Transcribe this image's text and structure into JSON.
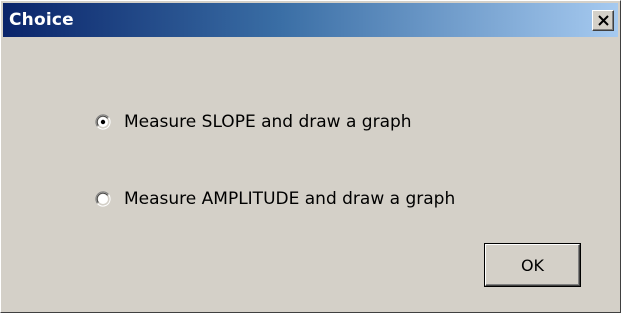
{
  "window": {
    "title": "Choice",
    "close_icon": "close-x-icon"
  },
  "options": [
    {
      "label": "Measure SLOPE and draw a graph",
      "selected": true
    },
    {
      "label": "Measure AMPLITUDE and draw a graph",
      "selected": false
    }
  ],
  "buttons": {
    "ok_label": "OK"
  },
  "colors": {
    "titlebar_start": "#0a246a",
    "titlebar_end": "#a6caf0",
    "dialog_background": "#d4d0c8"
  }
}
